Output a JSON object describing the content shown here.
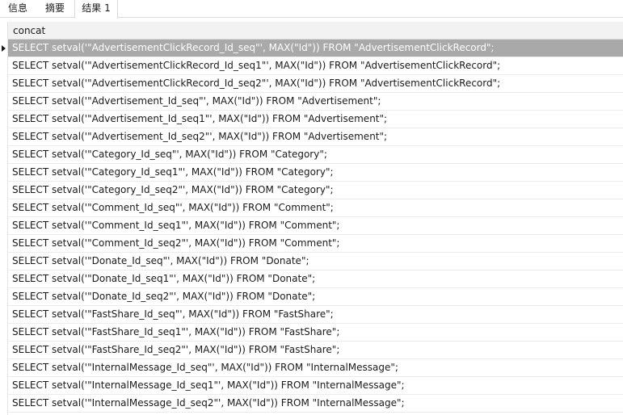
{
  "tabs": [
    {
      "label": "信息"
    },
    {
      "label": "摘要"
    },
    {
      "label": "结果 1"
    }
  ],
  "grid": {
    "column_header": "concat",
    "selected_row": 0,
    "rows": [
      "SELECT setval('\"AdvertisementClickRecord_Id_seq\"', MAX(\"Id\")) FROM \"AdvertisementClickRecord\";",
      "SELECT setval('\"AdvertisementClickRecord_Id_seq1\"', MAX(\"Id\")) FROM \"AdvertisementClickRecord\";",
      "SELECT setval('\"AdvertisementClickRecord_Id_seq2\"', MAX(\"Id\")) FROM \"AdvertisementClickRecord\";",
      "SELECT setval('\"Advertisement_Id_seq\"', MAX(\"Id\")) FROM \"Advertisement\";",
      "SELECT setval('\"Advertisement_Id_seq1\"', MAX(\"Id\")) FROM \"Advertisement\";",
      "SELECT setval('\"Advertisement_Id_seq2\"', MAX(\"Id\")) FROM \"Advertisement\";",
      "SELECT setval('\"Category_Id_seq\"', MAX(\"Id\")) FROM \"Category\";",
      "SELECT setval('\"Category_Id_seq1\"', MAX(\"Id\")) FROM \"Category\";",
      "SELECT setval('\"Category_Id_seq2\"', MAX(\"Id\")) FROM \"Category\";",
      "SELECT setval('\"Comment_Id_seq\"', MAX(\"Id\")) FROM \"Comment\";",
      "SELECT setval('\"Comment_Id_seq1\"', MAX(\"Id\")) FROM \"Comment\";",
      "SELECT setval('\"Comment_Id_seq2\"', MAX(\"Id\")) FROM \"Comment\";",
      "SELECT setval('\"Donate_Id_seq\"', MAX(\"Id\")) FROM \"Donate\";",
      "SELECT setval('\"Donate_Id_seq1\"', MAX(\"Id\")) FROM \"Donate\";",
      "SELECT setval('\"Donate_Id_seq2\"', MAX(\"Id\")) FROM \"Donate\";",
      "SELECT setval('\"FastShare_Id_seq\"', MAX(\"Id\")) FROM \"FastShare\";",
      "SELECT setval('\"FastShare_Id_seq1\"', MAX(\"Id\")) FROM \"FastShare\";",
      "SELECT setval('\"FastShare_Id_seq2\"', MAX(\"Id\")) FROM \"FastShare\";",
      "SELECT setval('\"InternalMessage_Id_seq\"', MAX(\"Id\")) FROM \"InternalMessage\";",
      "SELECT setval('\"InternalMessage_Id_seq1\"', MAX(\"Id\")) FROM \"InternalMessage\";",
      "SELECT setval('\"InternalMessage_Id_seq2\"', MAX(\"Id\")) FROM \"InternalMessage\";"
    ]
  }
}
